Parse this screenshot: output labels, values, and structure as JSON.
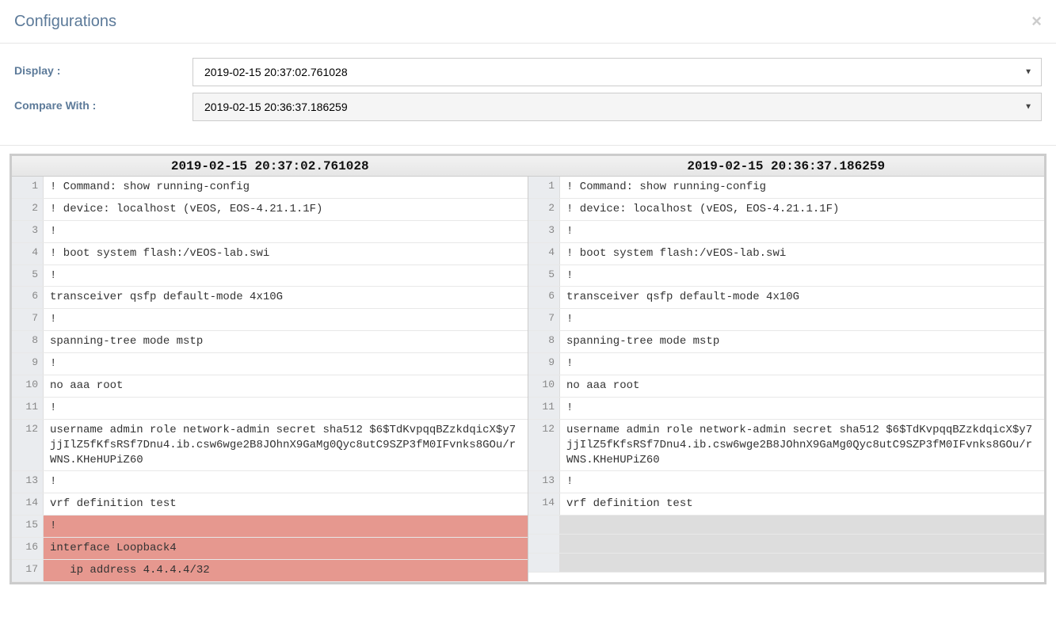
{
  "header": {
    "title": "Configurations",
    "close": "×"
  },
  "controls": {
    "display_label": "Display :",
    "compare_label": "Compare With :",
    "display_value": "2019-02-15 20:37:02.761028",
    "compare_value": "2019-02-15 20:36:37.186259"
  },
  "diff": {
    "left_title": "2019-02-15 20:37:02.761028",
    "right_title": "2019-02-15 20:36:37.186259",
    "left": [
      {
        "n": "1",
        "t": "! Command: show running-config"
      },
      {
        "n": "2",
        "t": "! device: localhost (vEOS, EOS-4.21.1.1F)"
      },
      {
        "n": "3",
        "t": "!"
      },
      {
        "n": "4",
        "t": "! boot system flash:/vEOS-lab.swi"
      },
      {
        "n": "5",
        "t": "!"
      },
      {
        "n": "6",
        "t": "transceiver qsfp default-mode 4x10G"
      },
      {
        "n": "7",
        "t": "!"
      },
      {
        "n": "8",
        "t": "spanning-tree mode mstp"
      },
      {
        "n": "9",
        "t": "!"
      },
      {
        "n": "10",
        "t": "no aaa root"
      },
      {
        "n": "11",
        "t": "!"
      },
      {
        "n": "12",
        "t": "username admin role network-admin secret sha512 $6$TdKvpqqBZzkdqicX$y7jjIlZ5fKfsRSf7Dnu4.ib.csw6wge2B8JOhnX9GaMg0Qyc8utC9SZP3fM0IFvnks8GOu/rWNS.KHeHUPiZ60"
      },
      {
        "n": "13",
        "t": "!"
      },
      {
        "n": "14",
        "t": "vrf definition test"
      },
      {
        "n": "15",
        "t": "!",
        "mode": "removed"
      },
      {
        "n": "16",
        "t": "interface Loopback4",
        "mode": "removed"
      },
      {
        "n": "17",
        "t": "   ip address 4.4.4.4/32",
        "mode": "removed"
      }
    ],
    "right": [
      {
        "n": "1",
        "t": "! Command: show running-config"
      },
      {
        "n": "2",
        "t": "! device: localhost (vEOS, EOS-4.21.1.1F)"
      },
      {
        "n": "3",
        "t": "!"
      },
      {
        "n": "4",
        "t": "! boot system flash:/vEOS-lab.swi"
      },
      {
        "n": "5",
        "t": "!"
      },
      {
        "n": "6",
        "t": "transceiver qsfp default-mode 4x10G"
      },
      {
        "n": "7",
        "t": "!"
      },
      {
        "n": "8",
        "t": "spanning-tree mode mstp"
      },
      {
        "n": "9",
        "t": "!"
      },
      {
        "n": "10",
        "t": "no aaa root"
      },
      {
        "n": "11",
        "t": "!"
      },
      {
        "n": "12",
        "t": "username admin role network-admin secret sha512 $6$TdKvpqqBZzkdqicX$y7jjIlZ5fKfsRSf7Dnu4.ib.csw6wge2B8JOhnX9GaMg0Qyc8utC9SZP3fM0IFvnks8GOu/rWNS.KHeHUPiZ60"
      },
      {
        "n": "13",
        "t": "!"
      },
      {
        "n": "14",
        "t": "vrf definition test"
      },
      {
        "n": "",
        "t": "",
        "mode": "blank"
      },
      {
        "n": "",
        "t": "",
        "mode": "blank"
      },
      {
        "n": "",
        "t": "",
        "mode": "blank"
      }
    ]
  }
}
